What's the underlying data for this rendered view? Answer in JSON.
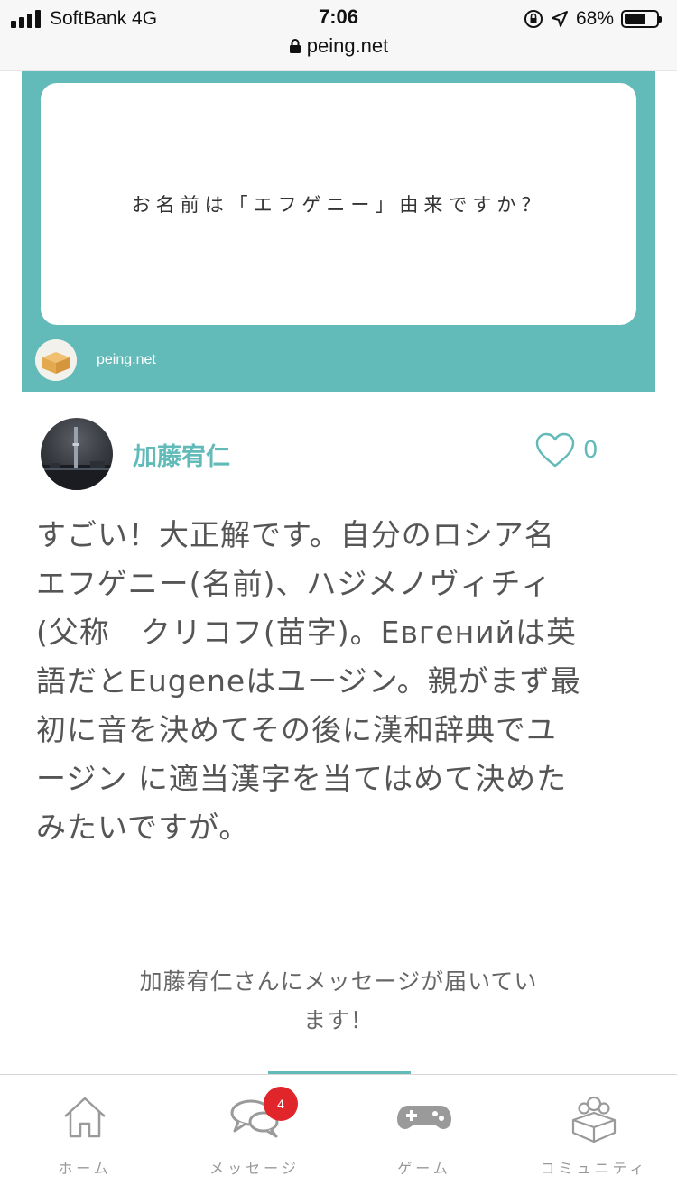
{
  "status_bar": {
    "carrier": "SoftBank 4G",
    "time": "7:06",
    "battery_percent": "68%",
    "battery_level": 0.68,
    "url": "peing.net"
  },
  "question_card": {
    "question": "お名前は「エフゲニー」由来ですか？",
    "site": "peing.net",
    "background_color": "#62bbb9"
  },
  "answer": {
    "username": "加藤宥仁",
    "like_count": "0",
    "lines": [
      "すごい！大正解です。自分のロシア名",
      "エフゲニー(名前)、ハジメノヴィチィ",
      "(父称　クリコフ(苗字)。Евгенийは英",
      "語だとEugeneはユージン。親がまず最",
      "初に音を決めてその後に漢和辞典でユ",
      "ージン に適当漢字を当てはめて決めた",
      "みたいですが。"
    ]
  },
  "notice": {
    "line1": "加藤宥仁さんにメッセージが届いてい",
    "line2": "ます！"
  },
  "tabbar": {
    "items": [
      {
        "label": "ホーム",
        "icon": "home-icon"
      },
      {
        "label": "メッセージ",
        "icon": "chat-bubbles-icon"
      },
      {
        "label": "ゲーム",
        "icon": "gamepad-icon"
      },
      {
        "label": "コミュニティ",
        "icon": "community-icon"
      }
    ],
    "message_badge": "4"
  },
  "colors": {
    "accent": "#62bbb9",
    "badge": "#e0252b",
    "text": "#555555"
  }
}
